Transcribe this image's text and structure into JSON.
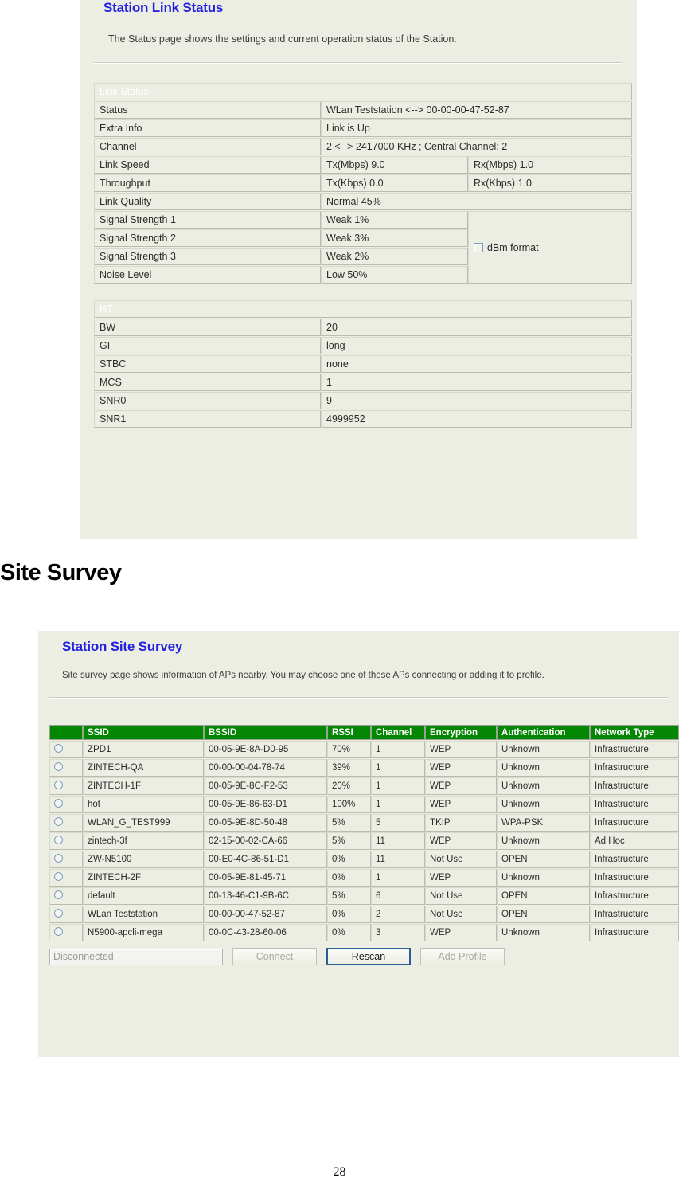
{
  "link_status_panel": {
    "title": "Station Link Status",
    "description": "The Status page shows the settings and current operation status of the Station.",
    "link_status_table": {
      "header": "Link Status",
      "rows": [
        {
          "label": "Status",
          "value": "WLan Teststation <--> 00-00-00-47-52-87"
        },
        {
          "label": "Extra Info",
          "value": "Link is Up"
        },
        {
          "label": "Channel",
          "value": "2 <--> 2417000 KHz ; Central Channel: 2"
        },
        {
          "label": "Link Speed",
          "value": "Tx(Mbps)  9.0",
          "value2": "Rx(Mbps)  1.0"
        },
        {
          "label": "Throughput",
          "value": "Tx(Kbps)  0.0",
          "value2": "Rx(Kbps)  1.0"
        },
        {
          "label": "Link Quality",
          "value": "Normal     45%"
        },
        {
          "label": "Signal Strength 1",
          "value": "Weak     1%"
        },
        {
          "label": "Signal Strength 2",
          "value": "Weak     3%"
        },
        {
          "label": "Signal Strength 3",
          "value": "Weak     2%"
        },
        {
          "label": "Noise Level",
          "value": "Low     50%"
        }
      ],
      "dbm_checkbox_label": "dBm format",
      "dbm_checkbox_checked": false
    },
    "ht_table": {
      "header": "HT",
      "rows": [
        {
          "label": "BW",
          "value": "20"
        },
        {
          "label": "GI",
          "value": "long"
        },
        {
          "label": "STBC",
          "value": "none"
        },
        {
          "label": "MCS",
          "value": "1"
        },
        {
          "label": "SNR0",
          "value": "9"
        },
        {
          "label": "SNR1",
          "value": "4999952"
        }
      ]
    }
  },
  "site_survey_heading": "Site Survey",
  "site_survey_panel": {
    "title": "Station Site Survey",
    "description": "Site survey page shows information of APs nearby. You may choose one of these APs connecting or adding it to profile.",
    "table": {
      "columns": [
        "",
        "SSID",
        "BSSID",
        "RSSI",
        "Channel",
        "Encryption",
        "Authentication",
        "Network Type"
      ],
      "rows": [
        {
          "ssid": "ZPD1",
          "bssid": "00-05-9E-8A-D0-95",
          "rssi": "70%",
          "channel": "1",
          "encryption": "WEP",
          "authentication": "Unknown",
          "network_type": "Infrastructure"
        },
        {
          "ssid": "ZINTECH-QA",
          "bssid": "00-00-00-04-78-74",
          "rssi": "39%",
          "channel": "1",
          "encryption": "WEP",
          "authentication": "Unknown",
          "network_type": "Infrastructure"
        },
        {
          "ssid": "ZINTECH-1F",
          "bssid": "00-05-9E-8C-F2-53",
          "rssi": "20%",
          "channel": "1",
          "encryption": "WEP",
          "authentication": "Unknown",
          "network_type": "Infrastructure"
        },
        {
          "ssid": "hot",
          "bssid": "00-05-9E-86-63-D1",
          "rssi": "100%",
          "channel": "1",
          "encryption": "WEP",
          "authentication": "Unknown",
          "network_type": "Infrastructure"
        },
        {
          "ssid": "WLAN_G_TEST999",
          "bssid": "00-05-9E-8D-50-48",
          "rssi": "5%",
          "channel": "5",
          "encryption": "TKIP",
          "authentication": "WPA-PSK",
          "network_type": "Infrastructure"
        },
        {
          "ssid": "zintech-3f",
          "bssid": "02-15-00-02-CA-66",
          "rssi": "5%",
          "channel": "11",
          "encryption": "WEP",
          "authentication": "Unknown",
          "network_type": "Ad Hoc"
        },
        {
          "ssid": "ZW-N5100",
          "bssid": "00-E0-4C-86-51-D1",
          "rssi": "0%",
          "channel": "11",
          "encryption": "Not Use",
          "authentication": "OPEN",
          "network_type": "Infrastructure"
        },
        {
          "ssid": "ZINTECH-2F",
          "bssid": "00-05-9E-81-45-71",
          "rssi": "0%",
          "channel": "1",
          "encryption": "WEP",
          "authentication": "Unknown",
          "network_type": "Infrastructure"
        },
        {
          "ssid": "default",
          "bssid": "00-13-46-C1-9B-6C",
          "rssi": "5%",
          "channel": "6",
          "encryption": "Not Use",
          "authentication": "OPEN",
          "network_type": "Infrastructure"
        },
        {
          "ssid": "WLan Teststation",
          "bssid": "00-00-00-47-52-87",
          "rssi": "0%",
          "channel": "2",
          "encryption": "Not Use",
          "authentication": "OPEN",
          "network_type": "Infrastructure"
        },
        {
          "ssid": "N5900-apcli-mega",
          "bssid": "00-0C-43-28-60-06",
          "rssi": "0%",
          "channel": "3",
          "encryption": "WEP",
          "authentication": "Unknown",
          "network_type": "Infrastructure"
        }
      ]
    },
    "controls": {
      "status_value": "Disconnected",
      "connect_label": "Connect",
      "rescan_label": "Rescan",
      "add_profile_label": "Add Profile"
    }
  },
  "footer": {
    "page_number": "28"
  },
  "colors": {
    "panel_background": "#eceee3",
    "table_header_green": "#038703",
    "title_blue": "#2222e0",
    "border": "#b9bdb0"
  }
}
